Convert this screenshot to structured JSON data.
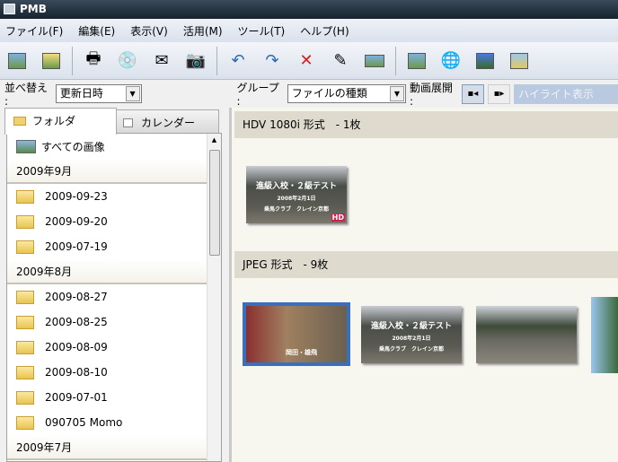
{
  "title": "PMB",
  "menu": [
    "ファイル(F)",
    "編集(E)",
    "表示(V)",
    "活用(M)",
    "ツール(T)",
    "ヘルプ(H)"
  ],
  "sort": {
    "label": "並べ替え :",
    "value": "更新日時"
  },
  "group": {
    "label": "グループ :",
    "value": "ファイルの種類",
    "video_label": "動画展開 :",
    "highlight_placeholder": "ハイライト表示"
  },
  "tabs": {
    "folder": "フォルダ",
    "calendar": "カレンダー"
  },
  "all_images": "すべての画像",
  "months": [
    "2009年9月",
    "2009年8月",
    "2009年7月"
  ],
  "sept": [
    "2009-09-23",
    "2009-09-20",
    "2009-07-19"
  ],
  "aug": [
    "2009-08-27",
    "2009-08-25",
    "2009-08-09",
    "2009-08-10",
    "2009-07-01",
    "090705 Momo"
  ],
  "groups": [
    {
      "title": "HDV 1080i 形式　- 1枚"
    },
    {
      "title": "JPEG 形式　- 9枚"
    }
  ],
  "thumb_text": {
    "t1": "進級入校・２級テスト",
    "t2": "2008年2月1日",
    "t3": "乗馬クラブ　クレイン京都",
    "badge": "HD",
    "jump": "岡田・雄飛"
  },
  "colors": {
    "selection": "#3a6fc0"
  }
}
